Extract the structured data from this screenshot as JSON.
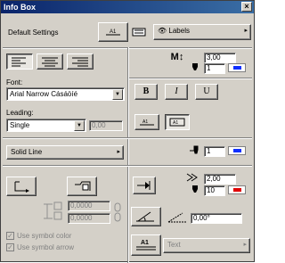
{
  "window": {
    "title": "Info Box",
    "close_glyph": "×"
  },
  "settings": {
    "default_label": "Default Settings",
    "labels_popup": "Labels",
    "arrow": "▸"
  },
  "text_size": {
    "value": "3,00"
  },
  "pen_top": {
    "value": "1",
    "color": "#1030ff"
  },
  "font": {
    "label": "Font:",
    "value": "Arial Narrow Cásáöíé"
  },
  "style_buttons": {
    "bold": "B",
    "italic": "I",
    "underline": "U"
  },
  "leading": {
    "label": "Leading:",
    "value": "Single",
    "value_field": "0,00"
  },
  "line_type": {
    "value": "Solid Line"
  },
  "pen_line": {
    "value": "1",
    "color": "#1030ff"
  },
  "spacing": {
    "value": "2,00"
  },
  "pen_bottom": {
    "value": "10",
    "color": "#e00000"
  },
  "offsets": {
    "x": "0,0000",
    "y": "0,0000"
  },
  "angle": {
    "value": "0,00°"
  },
  "checkboxes": {
    "symbol_color": "Use symbol color",
    "symbol_arrow": "Use symbol arrow"
  },
  "text_popup": {
    "value": "Text"
  },
  "dropdown_glyph": "▼"
}
